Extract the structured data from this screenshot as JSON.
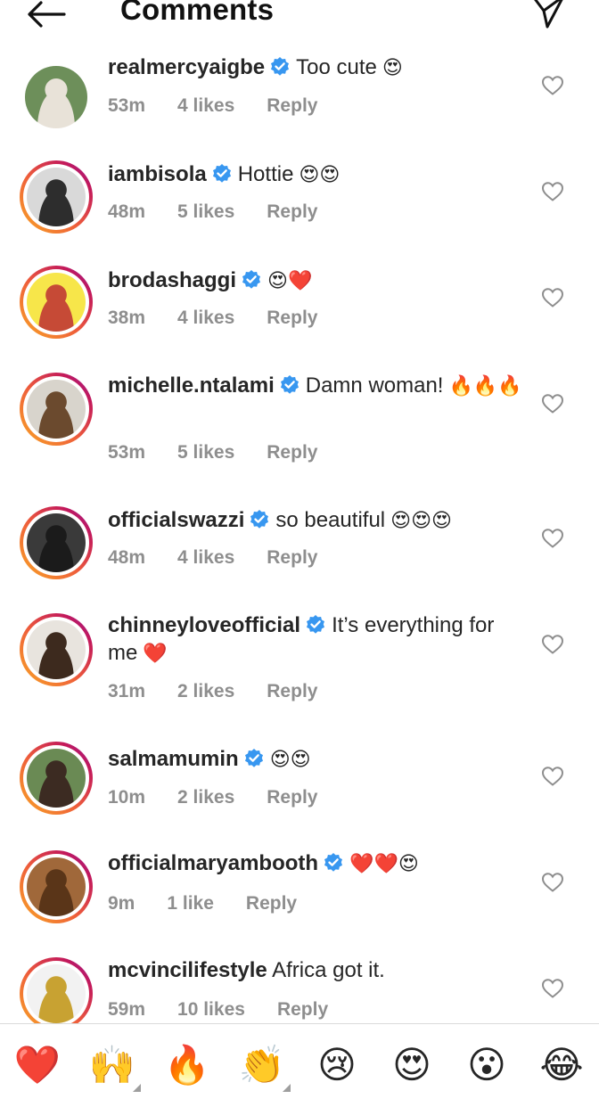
{
  "header": {
    "title": "Comments"
  },
  "comments": [
    {
      "username": "realmercyaigbe",
      "verified": true,
      "text": "Too cute",
      "emoji": "😍",
      "time": "53m",
      "likes": "4 likes",
      "reply": "Reply",
      "avatar_ring": false,
      "avatar_colors": [
        "#6d8f5a",
        "#e8e2d8"
      ]
    },
    {
      "username": "iambisola",
      "verified": true,
      "text": "Hottie",
      "emoji": "😍😍",
      "time": "48m",
      "likes": "5 likes",
      "reply": "Reply",
      "avatar_ring": true,
      "avatar_colors": [
        "#d9d9d9",
        "#2d2d2d"
      ]
    },
    {
      "username": "brodashaggi",
      "verified": true,
      "text": "",
      "emoji": "😍❤️",
      "time": "38m",
      "likes": "4 likes",
      "reply": "Reply",
      "avatar_ring": true,
      "avatar_colors": [
        "#f7e64a",
        "#c64a36"
      ]
    },
    {
      "username": "michelle.ntalami",
      "verified": true,
      "text": "Damn woman!",
      "emoji": "🔥🔥🔥",
      "time": "53m",
      "likes": "5 likes",
      "reply": "Reply",
      "avatar_ring": true,
      "avatar_colors": [
        "#d8d4cc",
        "#6b4a2e"
      ]
    },
    {
      "username": "officialswazzi",
      "verified": true,
      "text": "so beautiful",
      "emoji": "😍😍😍",
      "time": "48m",
      "likes": "4 likes",
      "reply": "Reply",
      "avatar_ring": true,
      "avatar_colors": [
        "#3a3a3a",
        "#1b1b1b"
      ]
    },
    {
      "username": "chinneyloveofficial",
      "verified": true,
      "text": "It’s everything for me",
      "emoji": "❤️",
      "time": "31m",
      "likes": "2 likes",
      "reply": "Reply",
      "avatar_ring": true,
      "avatar_colors": [
        "#e8e4de",
        "#3d2a1e"
      ]
    },
    {
      "username": "salmamumin",
      "verified": true,
      "text": "",
      "emoji": "😍😍",
      "time": "10m",
      "likes": "2 likes",
      "reply": "Reply",
      "avatar_ring": true,
      "avatar_colors": [
        "#6a8a54",
        "#3c2b22"
      ]
    },
    {
      "username": "officialmaryambooth",
      "verified": true,
      "text": "",
      "emoji": "❤️❤️😍",
      "time": "9m",
      "likes": "1 like",
      "reply": "Reply",
      "avatar_ring": true,
      "avatar_colors": [
        "#a0683a",
        "#5a3518"
      ]
    },
    {
      "username": "mcvincilifestyle",
      "verified": false,
      "text": "Africa got it.",
      "emoji": "",
      "time": "59m",
      "likes": "10 likes",
      "reply": "Reply",
      "avatar_ring": true,
      "avatar_colors": [
        "#f2f2f2",
        "#c8a232"
      ]
    }
  ],
  "quick_emojis": [
    "❤️",
    "🙌",
    "🔥",
    "👏",
    "😢",
    "😍",
    "😮",
    "😂"
  ],
  "colors": {
    "verified_blue": "#3897f0",
    "meta_gray": "#8e8e8e",
    "text": "#262626"
  }
}
